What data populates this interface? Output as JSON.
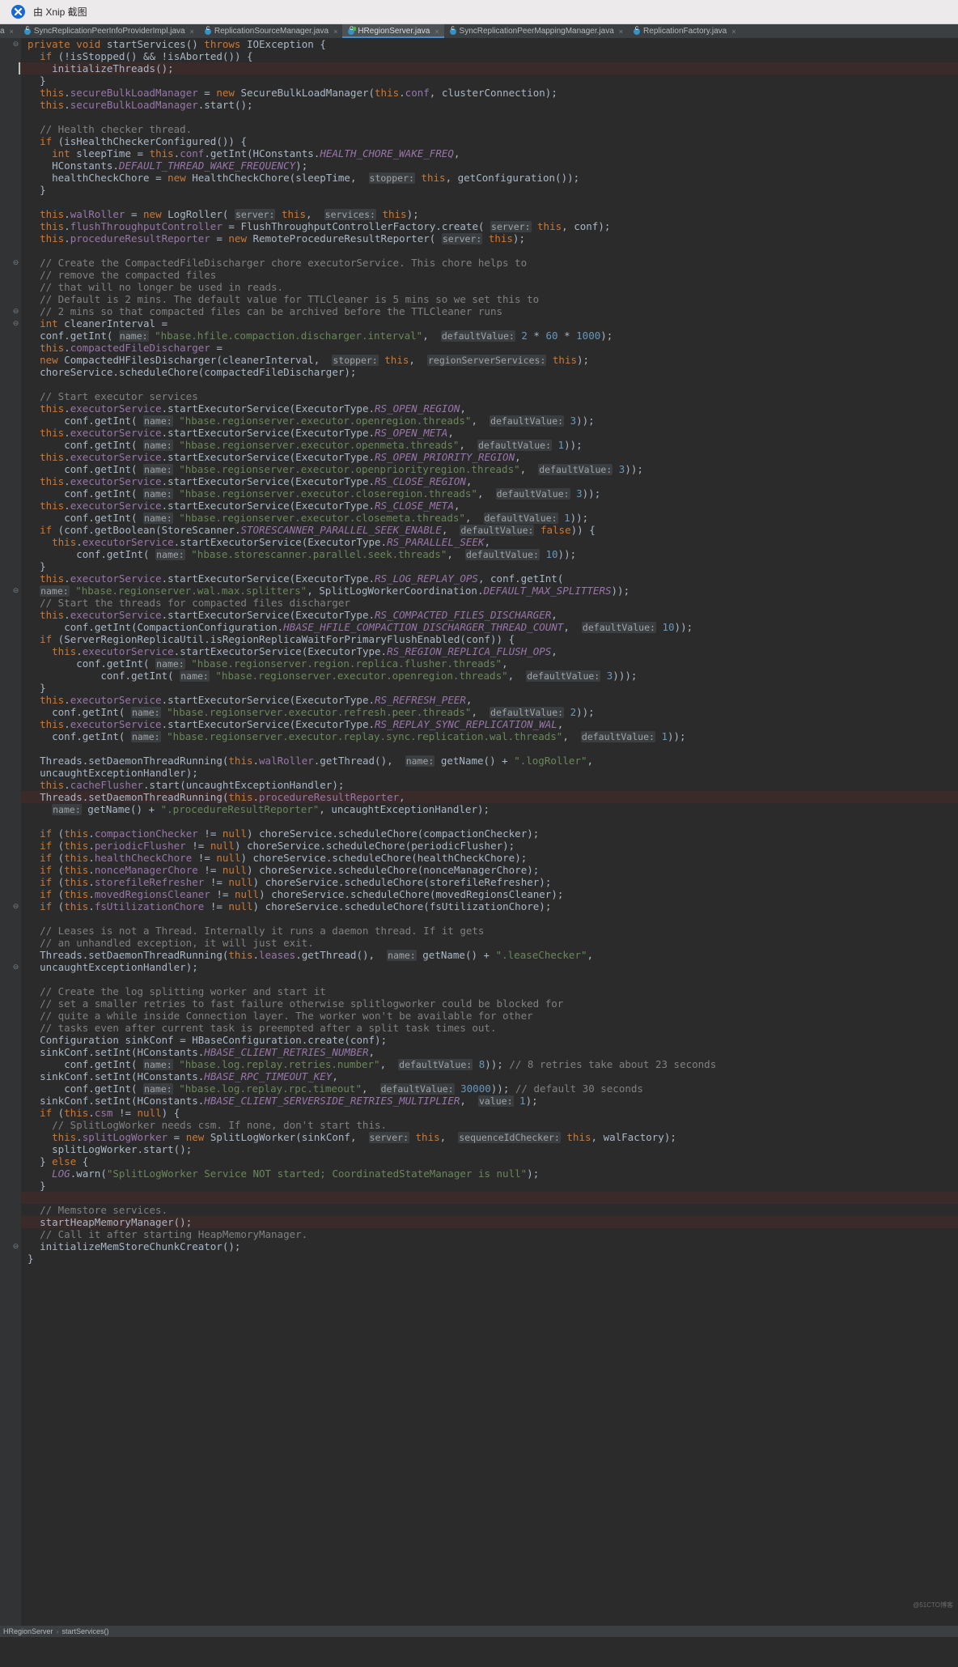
{
  "capture_bar": {
    "text": "由 Xnip 截图",
    "logo_name": "xnip-logo"
  },
  "tabs": [
    {
      "label": "a",
      "partial": true,
      "active": false
    },
    {
      "label": "SyncReplicationPeerInfoProviderImpl.java",
      "partial": false,
      "active": false
    },
    {
      "label": "ReplicationSourceManager.java",
      "partial": false,
      "active": false
    },
    {
      "label": "HRegionServer.java",
      "partial": false,
      "active": true
    },
    {
      "label": "SyncReplicationPeerMappingManager.java",
      "partial": false,
      "active": false
    },
    {
      "label": "ReplicationFactory.java",
      "partial": false,
      "active": false
    }
  ],
  "status_bar": {
    "class_name": "HRegionServer",
    "separator": "›",
    "method_name": "startServices()"
  },
  "watermark": "@51CTO博客",
  "colors": {
    "editor_bg": "#2b2b2b",
    "gutter_bg": "#313335",
    "tabbar_bg": "#3c3f41",
    "tab_active_bg": "#4e5254",
    "tab_active_underline": "#4a88c7",
    "keyword": "#cc7832",
    "field": "#9876aa",
    "string": "#6a8759",
    "number": "#6897bb",
    "comment": "#808080",
    "text": "#a9b7c6",
    "method": "#ffc66d",
    "hint_bg": "#3b3e40",
    "highlight_line": "#3a2a2a"
  },
  "code": {
    "file": "HRegionServer.java",
    "method": "startServices()",
    "lines": [
      "private void startServices() throws IOException {",
      "  if (!isStopped() && !isAborted()) {",
      "    initializeThreads();",
      "  }",
      "  this.secureBulkLoadManager = new SecureBulkLoadManager(this.conf, clusterConnection);",
      "  this.secureBulkLoadManager.start();",
      "",
      "  // Health checker thread.",
      "  if (isHealthCheckerConfigured()) {",
      "    int sleepTime = this.conf.getInt(HConstants.HEALTH_CHORE_WAKE_FREQ,",
      "    HConstants.DEFAULT_THREAD_WAKE_FREQUENCY);",
      "    healthCheckChore = new HealthCheckChore(sleepTime,  stopper: this, getConfiguration());",
      "  }",
      "",
      "  this.walRoller = new LogRoller( server: this,  services: this);",
      "  this.flushThroughputController = FlushThroughputControllerFactory.create( server: this, conf);",
      "  this.procedureResultReporter = new RemoteProcedureResultReporter( server: this);",
      "",
      "  // Create the CompactedFileDischarger chore executorService. This chore helps to",
      "  // remove the compacted files",
      "  // that will no longer be used in reads.",
      "  // Default is 2 mins. The default value for TTLCleaner is 5 mins so we set this to",
      "  // 2 mins so that compacted files can be archived before the TTLCleaner runs",
      "  int cleanerInterval =",
      "  conf.getInt( name: \"hbase.hfile.compaction.discharger.interval\",  defaultValue: 2 * 60 * 1000);",
      "  this.compactedFileDischarger =",
      "  new CompactedHFilesDischarger(cleanerInterval,  stopper: this,  regionServerServices: this);",
      "  choreService.scheduleChore(compactedFileDischarger);",
      "",
      "  // Start executor services",
      "  this.executorService.startExecutorService(ExecutorType.RS_OPEN_REGION,",
      "      conf.getInt( name: \"hbase.regionserver.executor.openregion.threads\",  defaultValue: 3));",
      "  this.executorService.startExecutorService(ExecutorType.RS_OPEN_META,",
      "      conf.getInt( name: \"hbase.regionserver.executor.openmeta.threads\",  defaultValue: 1));",
      "  this.executorService.startExecutorService(ExecutorType.RS_OPEN_PRIORITY_REGION,",
      "      conf.getInt( name: \"hbase.regionserver.executor.openpriorityregion.threads\",  defaultValue: 3));",
      "  this.executorService.startExecutorService(ExecutorType.RS_CLOSE_REGION,",
      "      conf.getInt( name: \"hbase.regionserver.executor.closeregion.threads\",  defaultValue: 3));",
      "  this.executorService.startExecutorService(ExecutorType.RS_CLOSE_META,",
      "      conf.getInt( name: \"hbase.regionserver.executor.closemeta.threads\",  defaultValue: 1));",
      "  if (conf.getBoolean(StoreScanner.STORESCANNER_PARALLEL_SEEK_ENABLE,  defaultValue: false)) {",
      "    this.executorService.startExecutorService(ExecutorType.RS_PARALLEL_SEEK,",
      "        conf.getInt( name: \"hbase.storescanner.parallel.seek.threads\",  defaultValue: 10));",
      "  }",
      "  this.executorService.startExecutorService(ExecutorType.RS_LOG_REPLAY_OPS, conf.getInt(",
      "  name: \"hbase.regionserver.wal.max.splitters\", SplitLogWorkerCoordination.DEFAULT_MAX_SPLITTERS));",
      "  // Start the threads for compacted files discharger",
      "  this.executorService.startExecutorService(ExecutorType.RS_COMPACTED_FILES_DISCHARGER,",
      "      conf.getInt(CompactionConfiguration.HBASE_HFILE_COMPACTION_DISCHARGER_THREAD_COUNT,  defaultValue: 10));",
      "  if (ServerRegionReplicaUtil.isRegionReplicaWaitForPrimaryFlushEnabled(conf)) {",
      "    this.executorService.startExecutorService(ExecutorType.RS_REGION_REPLICA_FLUSH_OPS,",
      "        conf.getInt( name: \"hbase.regionserver.region.replica.flusher.threads\",",
      "            conf.getInt( name: \"hbase.regionserver.executor.openregion.threads\",  defaultValue: 3)));",
      "  }",
      "  this.executorService.startExecutorService(ExecutorType.RS_REFRESH_PEER,",
      "    conf.getInt( name: \"hbase.regionserver.executor.refresh.peer.threads\",  defaultValue: 2));",
      "  this.executorService.startExecutorService(ExecutorType.RS_REPLAY_SYNC_REPLICATION_WAL,",
      "    conf.getInt( name: \"hbase.regionserver.executor.replay.sync.replication.wal.threads\",  defaultValue: 1));",
      "",
      "  Threads.setDaemonThreadRunning(this.walRoller.getThread(),  name: getName() + \".logRoller\",",
      "  uncaughtExceptionHandler);",
      "  this.cacheFlusher.start(uncaughtExceptionHandler);",
      "  Threads.setDaemonThreadRunning(this.procedureResultReporter,",
      "    name: getName() + \".procedureResultReporter\", uncaughtExceptionHandler);",
      "",
      "  if (this.compactionChecker != null) choreService.scheduleChore(compactionChecker);",
      "  if (this.periodicFlusher != null) choreService.scheduleChore(periodicFlusher);",
      "  if (this.healthCheckChore != null) choreService.scheduleChore(healthCheckChore);",
      "  if (this.nonceManagerChore != null) choreService.scheduleChore(nonceManagerChore);",
      "  if (this.storefileRefresher != null) choreService.scheduleChore(storefileRefresher);",
      "  if (this.movedRegionsCleaner != null) choreService.scheduleChore(movedRegionsCleaner);",
      "  if (this.fsUtilizationChore != null) choreService.scheduleChore(fsUtilizationChore);",
      "",
      "  // Leases is not a Thread. Internally it runs a daemon thread. If it gets",
      "  // an unhandled exception, it will just exit.",
      "  Threads.setDaemonThreadRunning(this.leases.getThread(),  name: getName() + \".leaseChecker\",",
      "  uncaughtExceptionHandler);",
      "",
      "  // Create the log splitting worker and start it",
      "  // set a smaller retries to fast failure otherwise splitlogworker could be blocked for",
      "  // quite a while inside Connection layer. The worker won't be available for other",
      "  // tasks even after current task is preempted after a split task times out.",
      "  Configuration sinkConf = HBaseConfiguration.create(conf);",
      "  sinkConf.setInt(HConstants.HBASE_CLIENT_RETRIES_NUMBER,",
      "      conf.getInt( name: \"hbase.log.replay.retries.number\",  defaultValue: 8)); // 8 retries take about 23 seconds",
      "  sinkConf.setInt(HConstants.HBASE_RPC_TIMEOUT_KEY,",
      "      conf.getInt( name: \"hbase.log.replay.rpc.timeout\",  defaultValue: 30000)); // default 30 seconds",
      "  sinkConf.setInt(HConstants.HBASE_CLIENT_SERVERSIDE_RETRIES_MULTIPLIER,  value: 1);",
      "  if (this.csm != null) {",
      "    // SplitLogWorker needs csm. If none, don't start this.",
      "    this.splitLogWorker = new SplitLogWorker(sinkConf,  server: this,  sequenceIdChecker: this, walFactory);",
      "    splitLogWorker.start();",
      "  } else {",
      "    LOG.warn(\"SplitLogWorker Service NOT started; CoordinatedStateManager is null\");",
      "  }",
      "",
      "  // Memstore services.",
      "  startHeapMemoryManager();",
      "  // Call it after starting HeapMemoryManager.",
      "  initializeMemStoreChunkCreator();",
      "}"
    ]
  }
}
